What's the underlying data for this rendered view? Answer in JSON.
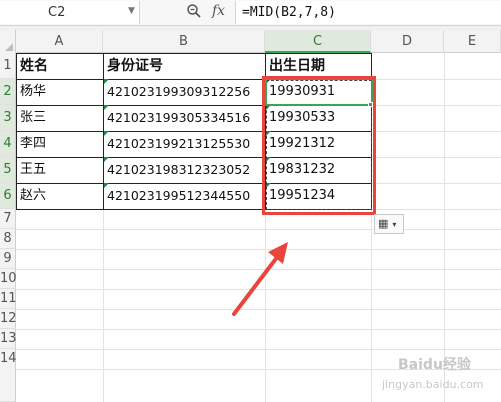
{
  "formula_bar": {
    "cell_ref": "C2",
    "formula": "=MID(B2,7,8)",
    "zoom_icon": "zoom-icon",
    "fx_label": "fx"
  },
  "columns": [
    "A",
    "B",
    "C",
    "D",
    "E"
  ],
  "rows": [
    "1",
    "2",
    "3",
    "4",
    "5",
    "6",
    "7",
    "8",
    "9",
    "10",
    "11",
    "12",
    "13",
    "14"
  ],
  "table": {
    "headers": [
      "姓名",
      "身份证号",
      "出生日期"
    ],
    "rows": [
      {
        "name": "杨华",
        "id": "421023199309312256",
        "birth": "19930931"
      },
      {
        "name": "张三",
        "id": "421023199305334516",
        "birth": "19930533"
      },
      {
        "name": "李四",
        "id": "421023199213125530",
        "birth": "19921312"
      },
      {
        "name": "王五",
        "id": "421023198312323052",
        "birth": "19831232"
      },
      {
        "name": "赵六",
        "id": "421023199512344550",
        "birth": "19951234"
      }
    ]
  },
  "selection": {
    "active_cell": "C2",
    "range": "C2:C6"
  },
  "colors": {
    "accent_green": "#3aa357",
    "highlight_red": "#e8453c",
    "header_bg": "#f3f3f3"
  },
  "watermark": {
    "title": "Baidu经验",
    "url": "jingyan.baidu.com"
  }
}
